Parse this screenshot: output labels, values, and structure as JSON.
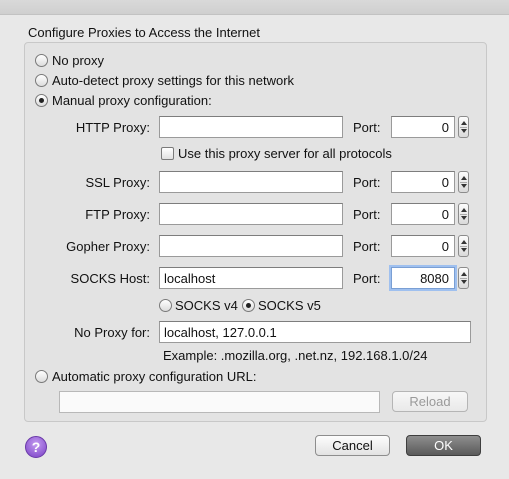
{
  "dialog": {
    "title": "Configure Proxies to Access the Internet"
  },
  "proxy_mode": {
    "no_proxy": "No proxy",
    "auto_detect": "Auto-detect proxy settings for this network",
    "manual": "Manual proxy configuration:",
    "auto_url": "Automatic proxy configuration URL:",
    "selected": "manual"
  },
  "http": {
    "label": "HTTP Proxy:",
    "host": "",
    "port_label": "Port:",
    "port": "0"
  },
  "use_for_all": {
    "label": "Use this proxy server for all protocols",
    "checked": false
  },
  "ssl": {
    "label": "SSL Proxy:",
    "host": "",
    "port_label": "Port:",
    "port": "0"
  },
  "ftp": {
    "label": "FTP Proxy:",
    "host": "",
    "port_label": "Port:",
    "port": "0"
  },
  "gopher": {
    "label": "Gopher Proxy:",
    "host": "",
    "port_label": "Port:",
    "port": "0"
  },
  "socks": {
    "label": "SOCKS Host:",
    "host": "localhost",
    "port_label": "Port:",
    "port": "8080",
    "v4_label": "SOCKS v4",
    "v5_label": "SOCKS v5",
    "version_selected": "v5"
  },
  "no_proxy_for": {
    "label": "No Proxy for:",
    "value": "localhost, 127.0.0.1",
    "example": "Example: .mozilla.org, .net.nz, 192.168.1.0/24"
  },
  "auto_config": {
    "url": "",
    "reload_label": "Reload"
  },
  "buttons": {
    "help": "?",
    "cancel": "Cancel",
    "ok": "OK"
  },
  "colors": {
    "focus_ring": "#9fc0ef",
    "default_button": "#6a6a6a",
    "help_button": "#8a4fd6"
  }
}
